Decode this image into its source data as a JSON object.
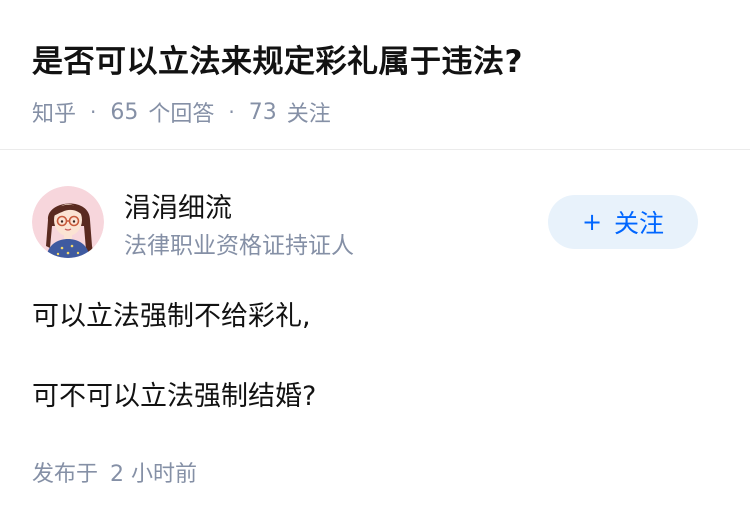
{
  "question": {
    "title": "是否可以立法来规定彩礼属于违法?",
    "source": "知乎",
    "separator": "·",
    "answer_count": "65",
    "answer_label": "个回答",
    "follower_count": "73",
    "follower_label": "关注"
  },
  "answer": {
    "author_name": "涓涓细流",
    "author_badge": "法律职业资格证持证人",
    "follow_plus": "+",
    "follow_label": "关注",
    "lines": [
      "可以立法强制不给彩礼,",
      "可不可以立法强制结婚?"
    ],
    "published_label": "发布于",
    "published_time": "2 小时前"
  },
  "colors": {
    "accent": "#0066ff",
    "follow_bg": "#e8f2fb",
    "meta_text": "#8590a6",
    "main_text": "#121212"
  },
  "icons": {
    "avatar": "cartoon-woman-avatar"
  }
}
